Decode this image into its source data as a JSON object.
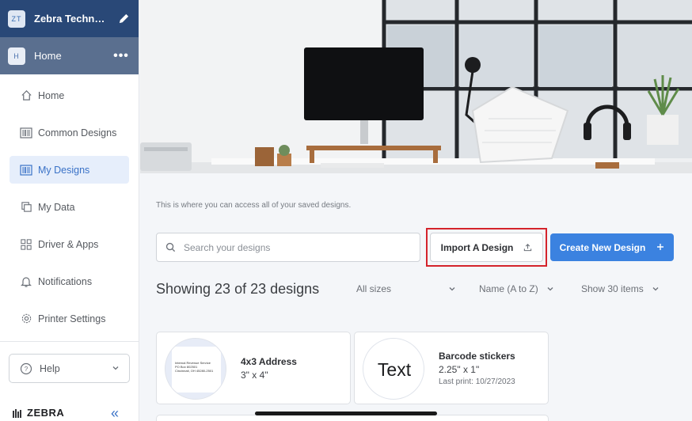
{
  "sidebar": {
    "org": {
      "initials": "ZT",
      "name": "Zebra Technolog...",
      "edit_icon": "pencil-icon"
    },
    "workspace": {
      "initials": "H",
      "name": "Home",
      "more_icon": "more-horizontal-icon"
    },
    "items": [
      {
        "label": "Home",
        "icon": "home-icon",
        "active": false
      },
      {
        "label": "Common Designs",
        "icon": "barcode-icon",
        "active": false
      },
      {
        "label": "My Designs",
        "icon": "barcode-icon",
        "active": true
      },
      {
        "label": "My Data",
        "icon": "data-icon",
        "active": false
      },
      {
        "label": "Driver & Apps",
        "icon": "grid-icon",
        "active": false
      },
      {
        "label": "Notifications",
        "icon": "bell-icon",
        "active": false
      },
      {
        "label": "Printer Settings",
        "icon": "gear-icon",
        "active": false
      }
    ],
    "help": {
      "label": "Help",
      "icon": "help-circle-icon"
    },
    "brand": "ZEBRA",
    "collapse_icon": "double-chevron-left-icon"
  },
  "main": {
    "intro": "This is where you can access all of your saved designs.",
    "search": {
      "placeholder": "Search your designs"
    },
    "import_label": "Import A Design",
    "create_label": "Create New Design",
    "showing": "Showing 23 of 23 designs",
    "filters": {
      "size": "All sizes",
      "sort": "Name (A to Z)",
      "per_page": "Show 30 items"
    },
    "cards": [
      {
        "title": "4x3 Address",
        "size": "3\" x 4\"",
        "last_print": "",
        "thumb_lines": [
          "Internal Revenue Service",
          "PO Box 802501",
          "Cincinnati, OH 45280-2501"
        ]
      },
      {
        "title": "Barcode stickers",
        "size": "2.25\" x 1\"",
        "last_print": "Last print: 10/27/2023",
        "thumb_text": "Text"
      }
    ]
  },
  "colors": {
    "accent": "#3b82e0",
    "sidebar_header": "#294877",
    "workspace_row": "#5a6f8f",
    "highlight": "#d4232b"
  }
}
